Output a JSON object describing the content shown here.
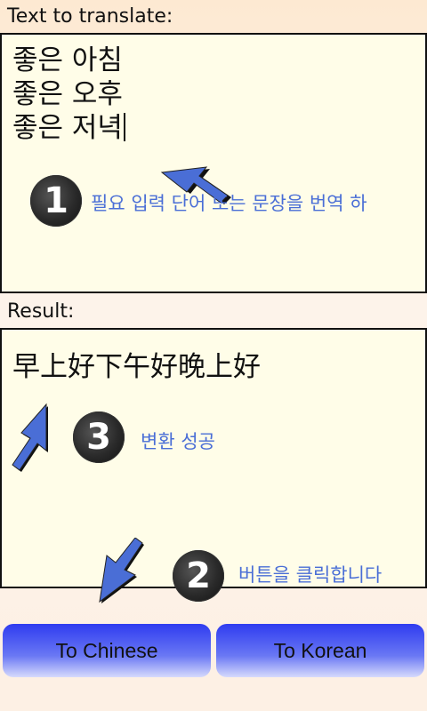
{
  "input_section": {
    "label": "Text to translate:",
    "text_lines": [
      "좋은 아침",
      "좋은 오후",
      "좋은 저녁"
    ]
  },
  "result_section": {
    "label": "Result:",
    "text": "早上好下午好晚上好"
  },
  "hints": {
    "step1_number": "1",
    "step1_text": "필요 입력 단어 또는 문장을 번역 하",
    "step2_number": "2",
    "step2_text": "버튼을 클릭합니다",
    "step3_number": "3",
    "step3_text": "변환 성공"
  },
  "buttons": {
    "to_chinese": "To Chinese",
    "to_korean": "To Korean"
  },
  "colors": {
    "accent_blue": "#4a6ed6",
    "button_blue": "#2f3cf0",
    "box_bg": "#fffde8"
  }
}
